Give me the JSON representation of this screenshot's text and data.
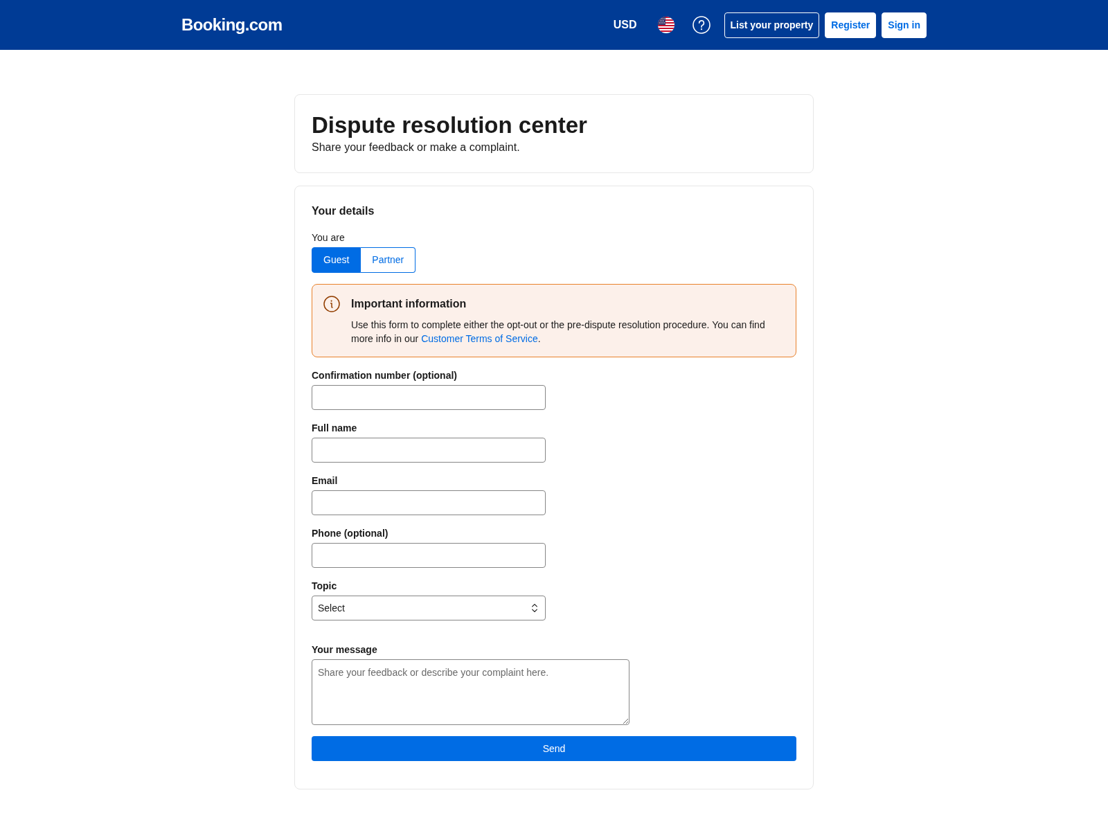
{
  "header": {
    "logo": "Booking.com",
    "currency": "USD",
    "buttons": [
      {
        "label": "List your property",
        "kind": "outline"
      },
      {
        "label": "Register",
        "kind": "solid"
      },
      {
        "label": "Sign in",
        "kind": "solid"
      }
    ]
  },
  "intro": {
    "title": "Dispute resolution center",
    "subtitle": "Share your feedback or make a complaint."
  },
  "form": {
    "heading": "Your details",
    "role_label": "You are",
    "roles": [
      {
        "label": "Guest",
        "selected": true
      },
      {
        "label": "Partner",
        "selected": false
      }
    ],
    "notice": {
      "title": "Important information",
      "text": "Use this form to complete either the opt-out or the pre-dispute resolution procedure. You can find more info in our ",
      "link": "Customer Terms of Service",
      "text_end": "."
    },
    "fields": [
      {
        "kind": "input",
        "label": "Confirmation number (optional)"
      },
      {
        "kind": "input",
        "label": "Full name"
      },
      {
        "kind": "input",
        "label": "Email"
      },
      {
        "kind": "input",
        "label": "Phone (optional)"
      },
      {
        "kind": "select",
        "label": "Topic",
        "value": "Select"
      },
      {
        "kind": "textarea",
        "label": "Your message",
        "placeholder": "Share your feedback or describe your complaint here."
      }
    ],
    "submit": "Send"
  }
}
